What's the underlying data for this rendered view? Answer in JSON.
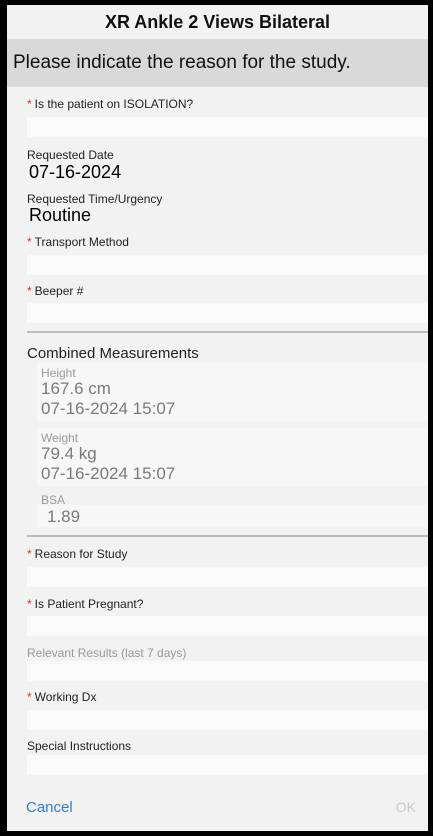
{
  "header": {
    "title": "XR Ankle 2 Views Bilateral"
  },
  "banner": {
    "text": "Please indicate the reason for the study."
  },
  "required_marker": "*",
  "fields": {
    "isolation": {
      "label": "Is the patient on ISOLATION?",
      "value": ""
    },
    "requested_date": {
      "label": "Requested Date",
      "value": "07-16-2024"
    },
    "requested_time": {
      "label": "Requested Time/Urgency",
      "value": "Routine"
    },
    "transport": {
      "label": "Transport Method",
      "value": ""
    },
    "beeper": {
      "label": "Beeper #",
      "value": ""
    },
    "reason": {
      "label": "Reason for Study",
      "value": ""
    },
    "pregnant": {
      "label": "Is Patient Pregnant?",
      "value": ""
    },
    "relevant": {
      "label": "Relevant Results (last 7 days)",
      "value": ""
    },
    "working_dx": {
      "label": "Working Dx",
      "value": ""
    },
    "special": {
      "label": "Special Instructions",
      "value": ""
    }
  },
  "measurements": {
    "title": "Combined Measurements",
    "height": {
      "label": "Height",
      "value": "167.6 cm",
      "date": "07-16-2024 15:07"
    },
    "weight": {
      "label": "Weight",
      "value": "79.4 kg",
      "date": "07-16-2024 15:07"
    },
    "bsa": {
      "label": "BSA",
      "value": "1.89"
    }
  },
  "footer": {
    "cancel": "Cancel",
    "ok": "OK"
  },
  "colors": {
    "required": "#e0312e",
    "link": "#2f7fd4",
    "disabled": "#c9c9c9"
  }
}
